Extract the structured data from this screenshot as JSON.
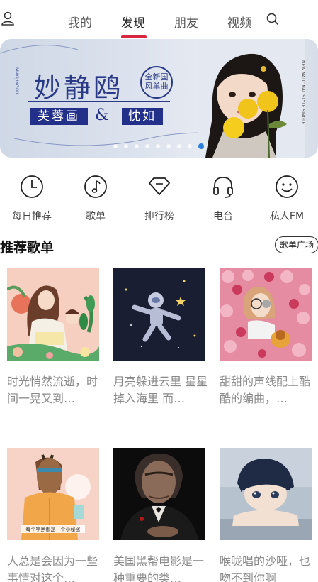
{
  "header": {
    "tabs": [
      {
        "label": "我的",
        "active": false
      },
      {
        "label": "发现",
        "active": true
      },
      {
        "label": "朋友",
        "active": false
      },
      {
        "label": "视频",
        "active": false
      }
    ],
    "accent_color": "#d7263d"
  },
  "banner": {
    "title": "妙静鸥",
    "seal_text": "全新国风单曲",
    "song_left": "芙蓉画",
    "amp": "&",
    "song_right": "忱如",
    "page_count": 9,
    "active_page": 8
  },
  "quick_entries": [
    {
      "label": "每日推荐",
      "icon": "clock-icon"
    },
    {
      "label": "歌单",
      "icon": "music-note-icon"
    },
    {
      "label": "排行榜",
      "icon": "diamond-icon"
    },
    {
      "label": "电台",
      "icon": "headphones-icon"
    },
    {
      "label": "私人FM",
      "icon": "smile-icon"
    }
  ],
  "section": {
    "title": "推荐歌单",
    "more_label": "歌单广场"
  },
  "playlists": [
    {
      "title": "时光悄然流逝，时间一晃又到…"
    },
    {
      "title": "月亮躲进云里 星星掉入海里 而…"
    },
    {
      "title": "甜甜的声线配上酷酷的编曲，…"
    },
    {
      "title": "人总是会因为一些事情对这个…"
    },
    {
      "title": "美国黑帮电影是一种重要的类…"
    },
    {
      "title": "喉咙唱的沙哑，也吻不到你啊"
    }
  ],
  "cover_captions": {
    "horse_caption": "每个宇黑都是一个小秘密"
  }
}
